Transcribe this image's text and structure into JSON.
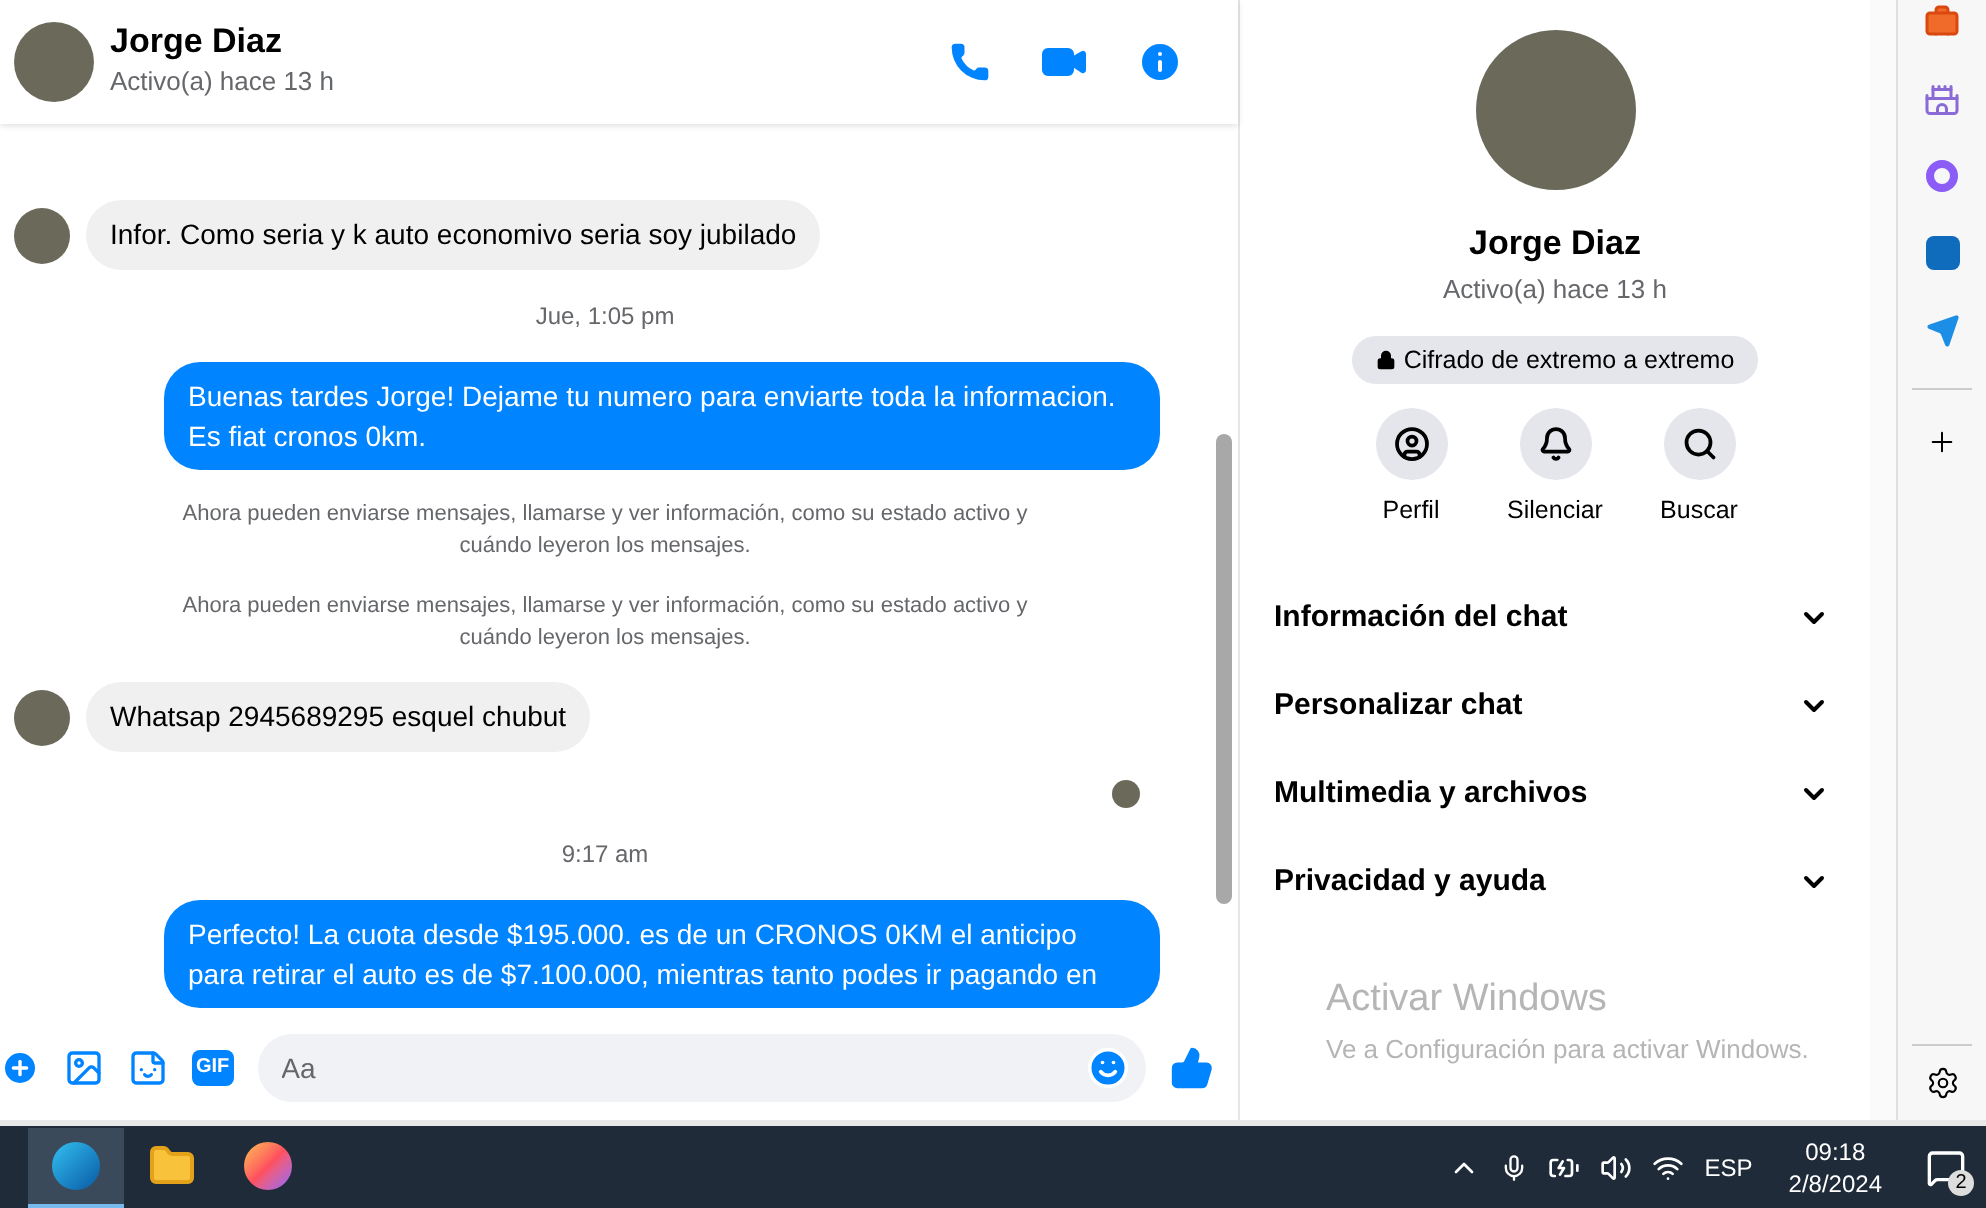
{
  "chat_header": {
    "name": "Jorge Diaz",
    "status": "Activo(a) hace 13 h"
  },
  "messages": [
    {
      "kind": "incoming",
      "text": "Infor. Como seria y k auto economivo seria soy jubilado",
      "avatar": true
    },
    {
      "kind": "timestamp",
      "text": "Jue, 1:05 pm"
    },
    {
      "kind": "outgoing",
      "text": "Buenas tardes Jorge! Dejame tu numero para enviarte toda la informacion. Es fiat cronos 0km."
    },
    {
      "kind": "notice",
      "text": "Ahora pueden enviarse mensajes, llamarse y ver información, como su estado activo y cuándo leyeron los mensajes."
    },
    {
      "kind": "notice",
      "text": "Ahora pueden enviarse mensajes, llamarse y ver información, como su estado activo y cuándo leyeron los mensajes."
    },
    {
      "kind": "incoming",
      "text": "Whatsap 2945689295 esquel chubut",
      "avatar": true
    },
    {
      "kind": "seen"
    },
    {
      "kind": "timestamp",
      "text": "9:17 am"
    },
    {
      "kind": "outgoing",
      "text": "Perfecto! La cuota desde $195.000. es de un CRONOS 0KM el anticipo para retirar el auto es de $7.100.000, mientras tanto podes ir pagando en"
    }
  ],
  "composer": {
    "placeholder": "Aa",
    "gif_button": "GIF"
  },
  "profile_panel": {
    "name": "Jorge Diaz",
    "status": "Activo(a) hace 13 h",
    "encryption_badge": "Cifrado de extremo a extremo",
    "actions": [
      {
        "kind": "profile",
        "label": "Perfil"
      },
      {
        "kind": "mute",
        "label": "Silenciar"
      },
      {
        "kind": "search",
        "label": "Buscar"
      }
    ],
    "sections": [
      {
        "label": "Información del chat",
        "expanded": false
      },
      {
        "label": "Personalizar chat",
        "expanded": false
      },
      {
        "label": "Multimedia y archivos",
        "expanded": false
      },
      {
        "label": "Privacidad y ayuda",
        "expanded": false
      }
    ]
  },
  "activation_notice": {
    "title": "Activar Windows",
    "subtitle": "Ve a Configuración para activar Windows."
  },
  "taskbar": {
    "apps": [
      {
        "kind": "edge",
        "selected": true
      },
      {
        "kind": "files",
        "selected": false
      },
      {
        "kind": "firefox",
        "selected": false
      }
    ],
    "language": "ESP",
    "time": "09:18",
    "date": "2/8/2024",
    "notifications": "2"
  }
}
